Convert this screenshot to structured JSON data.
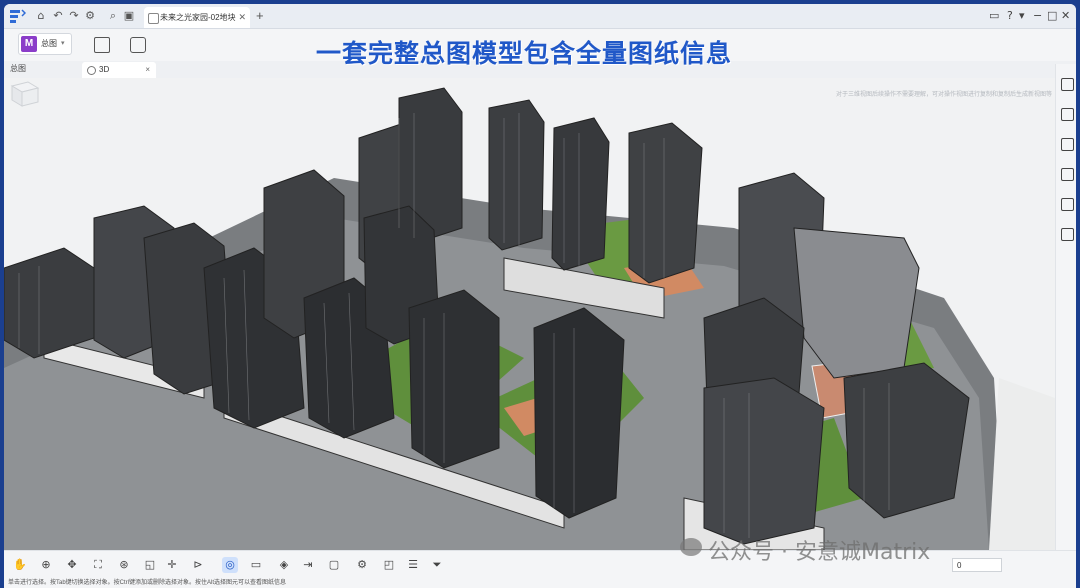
{
  "titlebar": {
    "doc_tab_title": "未来之光家园-02地块-...",
    "new_tab": "+",
    "window_controls": [
      "−",
      "□",
      "✕"
    ]
  },
  "toolbar": {
    "mode_label": "总图",
    "mode_icon": "M"
  },
  "headline": "一套完整总图模型包含全量图纸信息",
  "panel": {
    "side_title": "总图",
    "view_tab": "3D",
    "view_tab_close": "×"
  },
  "viewport": {
    "hint": "对于三维视图后续操作不需要理解，可对操作视图进行复制和复制后生成新视图等"
  },
  "bottom": {
    "zoom_value": "0"
  },
  "status": {
    "text": "单击进行选择。按Tab键切换选择对象。按Ctrl键添加或删除选择对象。按住Alt选择图元可以查看图纸信息"
  },
  "watermark": "公众号 · 安意诚Matrix",
  "colors": {
    "frame": "#1b3f8f",
    "headline": "#2058c8",
    "accent": "#8b3dc9",
    "active_tool": "#cfe0fb"
  }
}
